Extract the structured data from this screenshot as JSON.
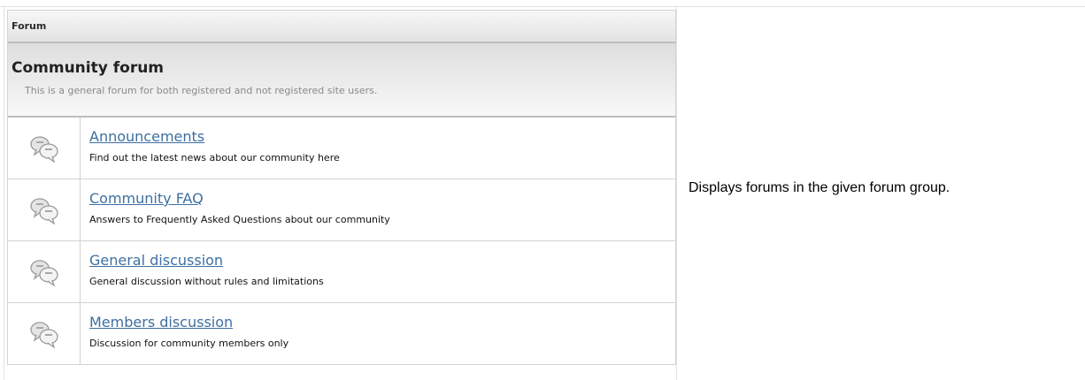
{
  "panel": {
    "title": "Forum"
  },
  "group": {
    "title": "Community forum",
    "description": "This is a general forum for both registered and not registered site users."
  },
  "forums": [
    {
      "name": "Announcements",
      "description": "Find out the latest news about our community here",
      "icon": "chat-bubbles-icon"
    },
    {
      "name": "Community FAQ",
      "description": "Answers to Frequently Asked Questions about our community",
      "icon": "chat-bubbles-icon"
    },
    {
      "name": "General discussion",
      "description": "General discussion without rules and limitations",
      "icon": "chat-bubbles-icon"
    },
    {
      "name": "Members discussion",
      "description": "Discussion for community members only",
      "icon": "chat-bubbles-icon"
    }
  ],
  "side_note": "Displays forums in the given forum group.",
  "colors": {
    "link": "#3d6fa0",
    "border": "#d3d3d3",
    "header_bg": "#e3e3e3"
  }
}
